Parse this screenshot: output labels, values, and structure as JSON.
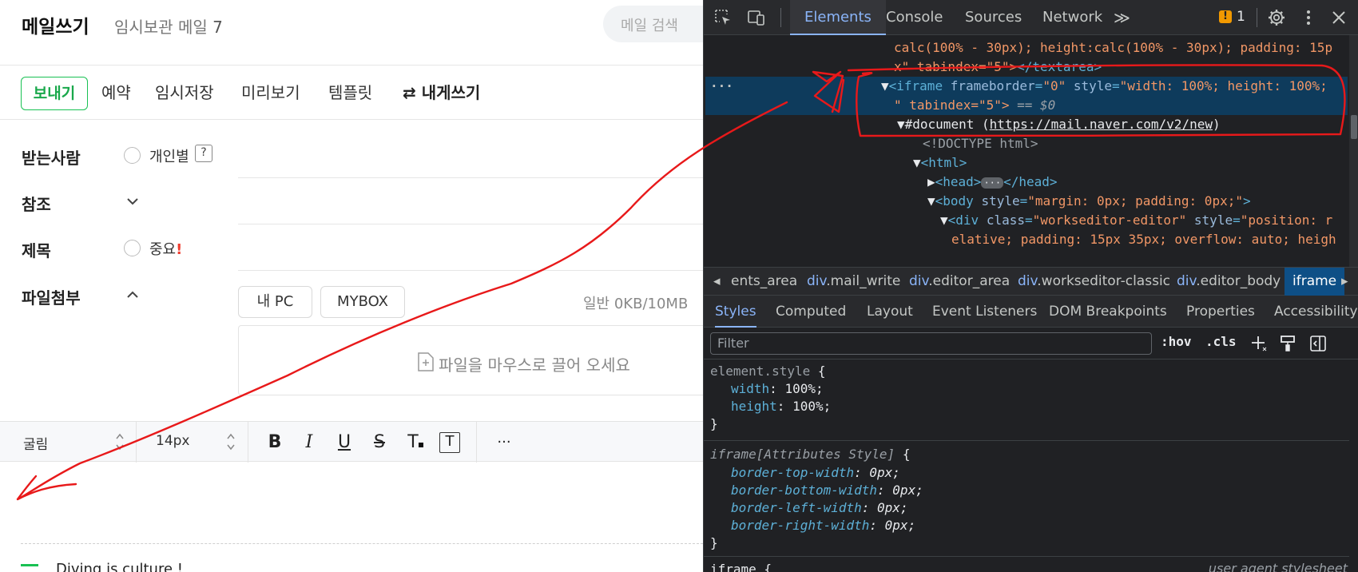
{
  "compose": {
    "title": "메일쓰기",
    "drafts_label": "임시보관 메일",
    "drafts_count": "7",
    "search_placeholder": "메일 검색",
    "toolbar": {
      "send": "보내기",
      "schedule": "예약",
      "save_draft": "임시저장",
      "preview": "미리보기",
      "template": "템플릿",
      "write_to_self": "내게쓰기",
      "write_to_self_icon": "swap-arrows-icon"
    },
    "recipients_label": "받는사람",
    "individual_label": "개인별",
    "help_mark": "?",
    "cc_label": "참조",
    "subject_label": "제목",
    "important_label": "중요",
    "important_mark": "!",
    "attach_label": "파일첨부",
    "my_pc_button": "내 PC",
    "mybox_button": "MYBOX",
    "attach_size": "일반 0KB/10MB",
    "drop_hint": "파일을 마우스로 끌어 오세요",
    "editor": {
      "font": "굴림",
      "size": "14px",
      "more": "···"
    },
    "body_text": "Diving is culture !"
  },
  "devtools": {
    "tabs": [
      "Elements",
      "Console",
      "Sources",
      "Network"
    ],
    "more_tabs": "≫",
    "issues_count": "1",
    "dom": {
      "line1": "calc(100% - 30px); height:calc(100% - 30px); padding: 15p",
      "line2_a": "x\" tabindex=\"5\">",
      "line2_b": "</textarea>",
      "iframe_open": "<iframe ",
      "iframe_attr1": "frameborder",
      "iframe_val1": "\"0\"",
      "iframe_attr2": " style",
      "iframe_val2": "\"width: 100%; height: 100%;",
      "iframe_line2": "\" tabindex=\"5\">",
      "iframe_line2_eq": " == $0",
      "doc_label": "#document (",
      "doc_url": "https://mail.naver.com/v2/new",
      "doc_close": ")",
      "doctype": "<!DOCTYPE html>",
      "html_tag": "<html>",
      "head_open": "<head>",
      "head_ellipsis": "···",
      "head_close": "</head>",
      "body_open": "<body ",
      "body_attr": "style",
      "body_val": "\"margin: 0px; padding: 0px;\"",
      "body_end": ">",
      "div_open": "<div ",
      "div_attr1": "class",
      "div_val1": "\"workseditor-editor\"",
      "div_attr2": " style",
      "div_val2": "\"position: r",
      "div_line2": "elative; padding: 15px 35px; overflow: auto; heigh",
      "ellipsis_marker": "···"
    },
    "breadcrumbs": [
      {
        "tag": "",
        "name": "ents_area"
      },
      {
        "tag": "div",
        "name": ".mail_write"
      },
      {
        "tag": "div",
        "name": ".editor_area"
      },
      {
        "tag": "div",
        "name": ".workseditor-classic"
      },
      {
        "tag": "div",
        "name": ".editor_body"
      },
      {
        "tag": "",
        "name": "iframe"
      }
    ],
    "subtabs": [
      "Styles",
      "Computed",
      "Layout",
      "Event Listeners",
      "DOM Breakpoints",
      "Properties",
      "Accessibility"
    ],
    "filter_placeholder": "Filter",
    "hov": ":hov",
    "cls": ".cls",
    "styles": {
      "element_selector": "element.style",
      "element_props": [
        {
          "name": "width",
          "value": "100%"
        },
        {
          "name": "height",
          "value": "100%"
        }
      ],
      "attr_selector": "iframe[Attributes Style]",
      "attr_props": [
        {
          "name": "border-top-width",
          "value": "0px"
        },
        {
          "name": "border-bottom-width",
          "value": "0px"
        },
        {
          "name": "border-left-width",
          "value": "0px"
        },
        {
          "name": "border-right-width",
          "value": "0px"
        }
      ],
      "ua_selector": "iframe",
      "ua_label": "user agent stylesheet"
    }
  },
  "annotation_color": "#e8191a"
}
